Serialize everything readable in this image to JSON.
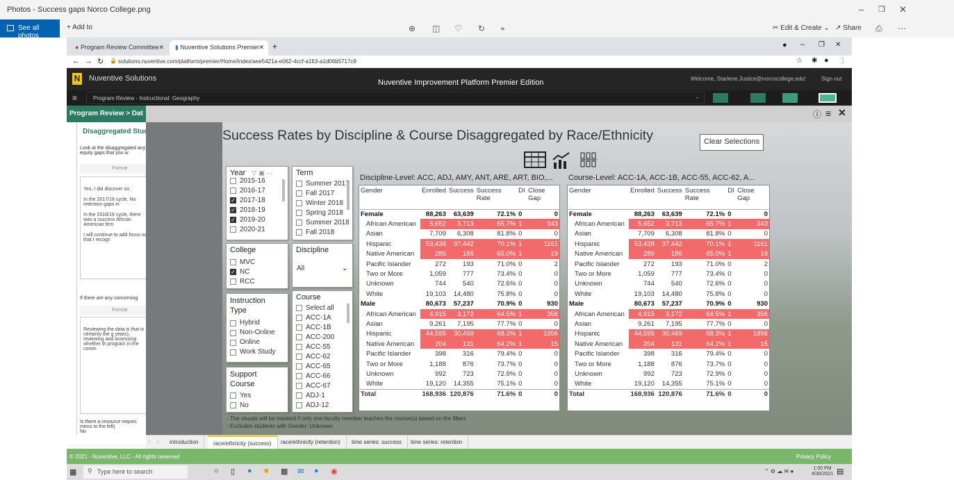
{
  "photos_title": "Photos - Success gaps Norco College.png",
  "photos_toolbar": {
    "see_all": "See all photos",
    "add_to": "Add to",
    "edit_create": "Edit & Create",
    "share": "Share"
  },
  "chrome": {
    "tab1": "Program Review Committee",
    "tab2": "Nuventive Solutions Premier",
    "url": "solutions.nuventive.com/platform/premier/Home/Index/aee5421a-e062-4ccf-a163-a1d06b5717c9"
  },
  "nuventive": {
    "brand": "Nuventive Solutions",
    "platform_title": "Nuventive Improvement Platform Premier Edition",
    "welcome": "Welcome, Starlene.Justice@norcocollege.edu!",
    "sign_out": "Sign out",
    "unit": "Program Review - Instructional: Geography",
    "breadcrumb": "Program Review > Dat",
    "footer_left": "© 2021 - Nuventive, LLC - All rights reserved",
    "footer_right": "Privacy Policy"
  },
  "left_panel": {
    "heading": "Disaggregated Stud",
    "prompt1": "Look at the disaggregated any equity gaps that you w",
    "format": "Format",
    "answer": [
      "Yes, I did discover so",
      "In the 2017/18 cycle, No retention gaps in",
      "In the 2018/19 cycle, there was a success African American fem",
      "I will continue to add focus so that I recogn"
    ],
    "prompt2": "If there are any concerning",
    "answer2": "Reviewing the data is that is certainly the g years), reviewing and assessing whether th program in the comin",
    "prompt3": "Is there a resource reques menu to the left)",
    "answer3": "No"
  },
  "report": {
    "title": "Success Rates by Discipline & Course Disaggregated by Race/Ethnicity",
    "clear_selections": "Clear Selections",
    "notes": [
      "- The visuals will be masked if only one faculty member teaches the course(s) based on the filters",
      "- Excludes students with Gender: Unknown"
    ],
    "tabs": [
      "introduction",
      "race/ethnicity (success)",
      "race/ethnicity (retention)",
      "time series: success",
      "time series: retention"
    ]
  },
  "slicers": {
    "year": {
      "title": "Year",
      "items": [
        {
          "label": "2015-16",
          "checked": false
        },
        {
          "label": "2016-17",
          "checked": false
        },
        {
          "label": "2017-18",
          "checked": true
        },
        {
          "label": "2018-19",
          "checked": true
        },
        {
          "label": "2019-20",
          "checked": true
        },
        {
          "label": "2020-21",
          "checked": false
        }
      ]
    },
    "term": {
      "title": "Term",
      "items": [
        {
          "label": "Summer 2017",
          "checked": false
        },
        {
          "label": "Fall 2017",
          "checked": false
        },
        {
          "label": "Winter 2018",
          "checked": false
        },
        {
          "label": "Spring 2018",
          "checked": false
        },
        {
          "label": "Summer 2018",
          "checked": false
        },
        {
          "label": "Fall 2018",
          "checked": false
        }
      ]
    },
    "college": {
      "title": "College",
      "items": [
        {
          "label": "MVC",
          "checked": false
        },
        {
          "label": "NC",
          "checked": true
        },
        {
          "label": "RCC",
          "checked": false
        }
      ]
    },
    "discipline": {
      "title": "Discipline",
      "value": "All"
    },
    "instruction": {
      "title1": "Instruction",
      "title2": "Type",
      "items": [
        {
          "label": "Hybrid",
          "checked": false
        },
        {
          "label": "Non-Online",
          "checked": false
        },
        {
          "label": "Online",
          "checked": false
        },
        {
          "label": "Work Study",
          "checked": false
        }
      ]
    },
    "course": {
      "title": "Course",
      "items": [
        {
          "label": "Select all",
          "checked": false
        },
        {
          "label": "ACC-1A",
          "checked": false
        },
        {
          "label": "ACC-1B",
          "checked": false
        },
        {
          "label": "ACC-200",
          "checked": false
        },
        {
          "label": "ACC-55",
          "checked": false
        },
        {
          "label": "ACC-62",
          "checked": false
        },
        {
          "label": "ACC-65",
          "checked": false
        },
        {
          "label": "ACC-66",
          "checked": false
        },
        {
          "label": "ACC-67",
          "checked": false
        },
        {
          "label": "ADJ-1",
          "checked": false
        },
        {
          "label": "ADJ-12",
          "checked": false
        }
      ]
    },
    "support": {
      "title1": "Support",
      "title2": "Course",
      "items": [
        {
          "label": "Yes",
          "checked": false
        },
        {
          "label": "No",
          "checked": false
        }
      ]
    }
  },
  "tables": {
    "discipline_title": "Discipline-Level: ACC, ADJ, AMY, ANT, ARE, ART, BIO,...",
    "course_title": "Course-Level: ACC-1A, ACC-1B, ACC-55, ACC-62, A...",
    "headers": [
      "Gender",
      "Enrolled",
      "Success",
      "Success Rate",
      "DI",
      "Close Gap"
    ],
    "rows": [
      {
        "type": "grp",
        "cells": [
          "Female",
          "88,263",
          "63,639",
          "72.1%",
          "0",
          "0"
        ],
        "di": false
      },
      {
        "type": "sub",
        "cells": [
          "African American",
          "5,652",
          "3,713",
          "65.7%",
          "1",
          "343"
        ],
        "di": true
      },
      {
        "type": "sub",
        "cells": [
          "Asian",
          "7,709",
          "6,308",
          "81.8%",
          "0",
          "0"
        ],
        "di": false
      },
      {
        "type": "sub",
        "cells": [
          "Hispanic",
          "53,438",
          "37,442",
          "70.1%",
          "1",
          "1161"
        ],
        "di": true
      },
      {
        "type": "sub",
        "cells": [
          "Native American",
          "286",
          "186",
          "65.0%",
          "1",
          "19"
        ],
        "di": true
      },
      {
        "type": "sub",
        "cells": [
          "Pacific Islander",
          "272",
          "193",
          "71.0%",
          "0",
          "2"
        ],
        "di": false
      },
      {
        "type": "sub",
        "cells": [
          "Two or More",
          "1,059",
          "777",
          "73.4%",
          "0",
          "0"
        ],
        "di": false
      },
      {
        "type": "sub",
        "cells": [
          "Unknown",
          "744",
          "540",
          "72.6%",
          "0",
          "0"
        ],
        "di": false
      },
      {
        "type": "sub",
        "cells": [
          "White",
          "19,103",
          "14,480",
          "75.8%",
          "0",
          "0"
        ],
        "di": false
      },
      {
        "type": "grp",
        "cells": [
          "Male",
          "80,673",
          "57,237",
          "70.9%",
          "0",
          "930"
        ],
        "di": false
      },
      {
        "type": "sub",
        "cells": [
          "African American",
          "4,915",
          "3,172",
          "64.5%",
          "1",
          "356"
        ],
        "di": true
      },
      {
        "type": "sub",
        "cells": [
          "Asian",
          "9,261",
          "7,195",
          "77.7%",
          "0",
          "0"
        ],
        "di": false
      },
      {
        "type": "sub",
        "cells": [
          "Hispanic",
          "44,595",
          "30,469",
          "68.3%",
          "1",
          "1956"
        ],
        "di": true
      },
      {
        "type": "sub",
        "cells": [
          "Native American",
          "204",
          "131",
          "64.2%",
          "1",
          "15"
        ],
        "di": true
      },
      {
        "type": "sub",
        "cells": [
          "Pacific Islander",
          "398",
          "316",
          "79.4%",
          "0",
          "0"
        ],
        "di": false
      },
      {
        "type": "sub",
        "cells": [
          "Two or More",
          "1,188",
          "876",
          "73.7%",
          "0",
          "0"
        ],
        "di": false
      },
      {
        "type": "sub",
        "cells": [
          "Unknown",
          "992",
          "723",
          "72.9%",
          "0",
          "0"
        ],
        "di": false
      },
      {
        "type": "sub",
        "cells": [
          "White",
          "19,120",
          "14,355",
          "75.1%",
          "0",
          "0"
        ],
        "di": false
      },
      {
        "type": "total",
        "cells": [
          "Total",
          "168,936",
          "120,876",
          "71.6%",
          "0",
          "0"
        ],
        "di": false
      }
    ]
  },
  "taskbar": {
    "search": "Type here to search",
    "time": "1:00 PM",
    "date": "4/30/2021"
  },
  "colors": {
    "di_highlight": "#f46a6a",
    "nv_green": "#2b7a61",
    "footer_green": "#79b86a",
    "photos_blue": "#0063b1"
  }
}
